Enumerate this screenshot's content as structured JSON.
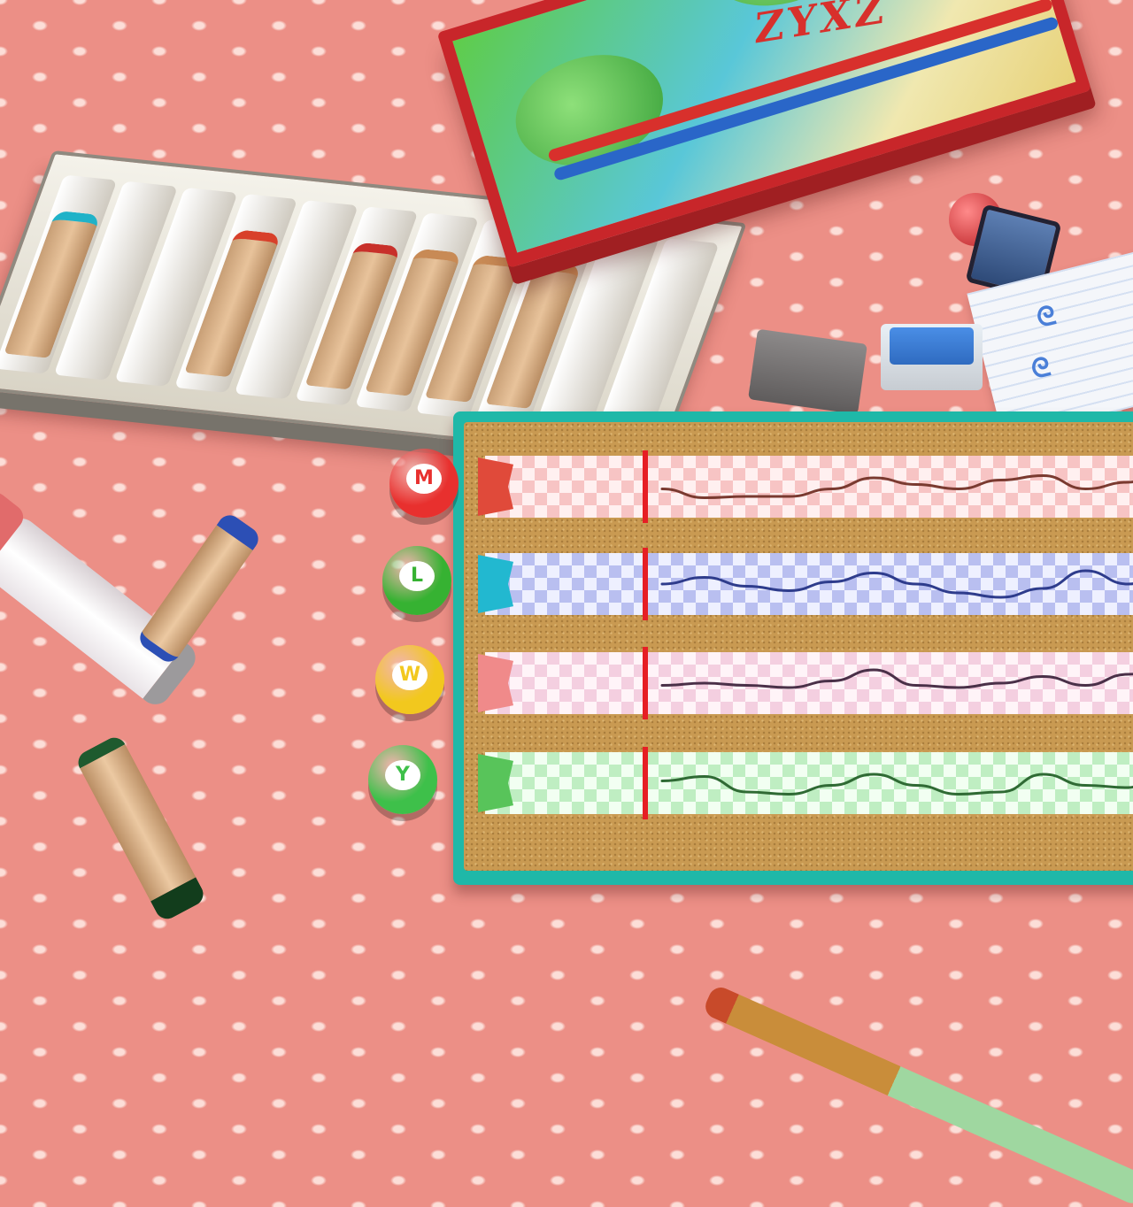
{
  "scene": {
    "box_label": "ZYXZ",
    "paper_marks": [
      "ᘓ",
      "ᘓ"
    ]
  },
  "tray": {
    "crayon_tips": [
      "#1fb2c8",
      "",
      "",
      "#d8402a",
      "",
      "#c8302a",
      "#c88a55",
      "#c88a55",
      "#c88a55",
      "",
      ""
    ]
  },
  "race": {
    "lanes": [
      {
        "racer": "mario",
        "emblem": "M",
        "racer_color": "#e8302e",
        "flag_color": "#e04a3a",
        "track_colors": [
          "#f7c4c4",
          "#fff0f0"
        ],
        "line_color": "#7a3a30",
        "path": [
          0.55,
          0.75,
          0.72,
          0.72,
          0.55,
          0.3,
          0.45,
          0.55,
          0.35,
          0.25,
          0.55,
          0.4,
          0.1
        ]
      },
      {
        "racer": "luigi",
        "emblem": "L",
        "racer_color": "#36b232",
        "flag_color": "#22b8d0",
        "track_colors": [
          "#b9bff0",
          "#eef0ff"
        ],
        "line_color": "#2e3c8c",
        "path": [
          0.5,
          0.35,
          0.55,
          0.65,
          0.45,
          0.25,
          0.5,
          0.7,
          0.8,
          0.6,
          0.2,
          0.5,
          0.25
        ]
      },
      {
        "racer": "wario",
        "emblem": "W",
        "racer_color": "#f2c81e",
        "flag_color": "#f08a8a",
        "track_colors": [
          "#f4cfe0",
          "#fff4f8"
        ],
        "line_color": "#4a3048",
        "path": [
          0.55,
          0.5,
          0.55,
          0.6,
          0.45,
          0.2,
          0.55,
          0.6,
          0.5,
          0.35,
          0.55,
          0.3,
          0.2
        ]
      },
      {
        "racer": "yoshi",
        "emblem": "Y",
        "racer_color": "#3ec04a",
        "flag_color": "#58c45a",
        "track_colors": [
          "#bfeec2",
          "#f2fff2"
        ],
        "line_color": "#2f6a34",
        "path": [
          0.45,
          0.35,
          0.7,
          0.75,
          0.55,
          0.3,
          0.55,
          0.75,
          0.7,
          0.3,
          0.55,
          0.6,
          0.1
        ]
      }
    ]
  }
}
